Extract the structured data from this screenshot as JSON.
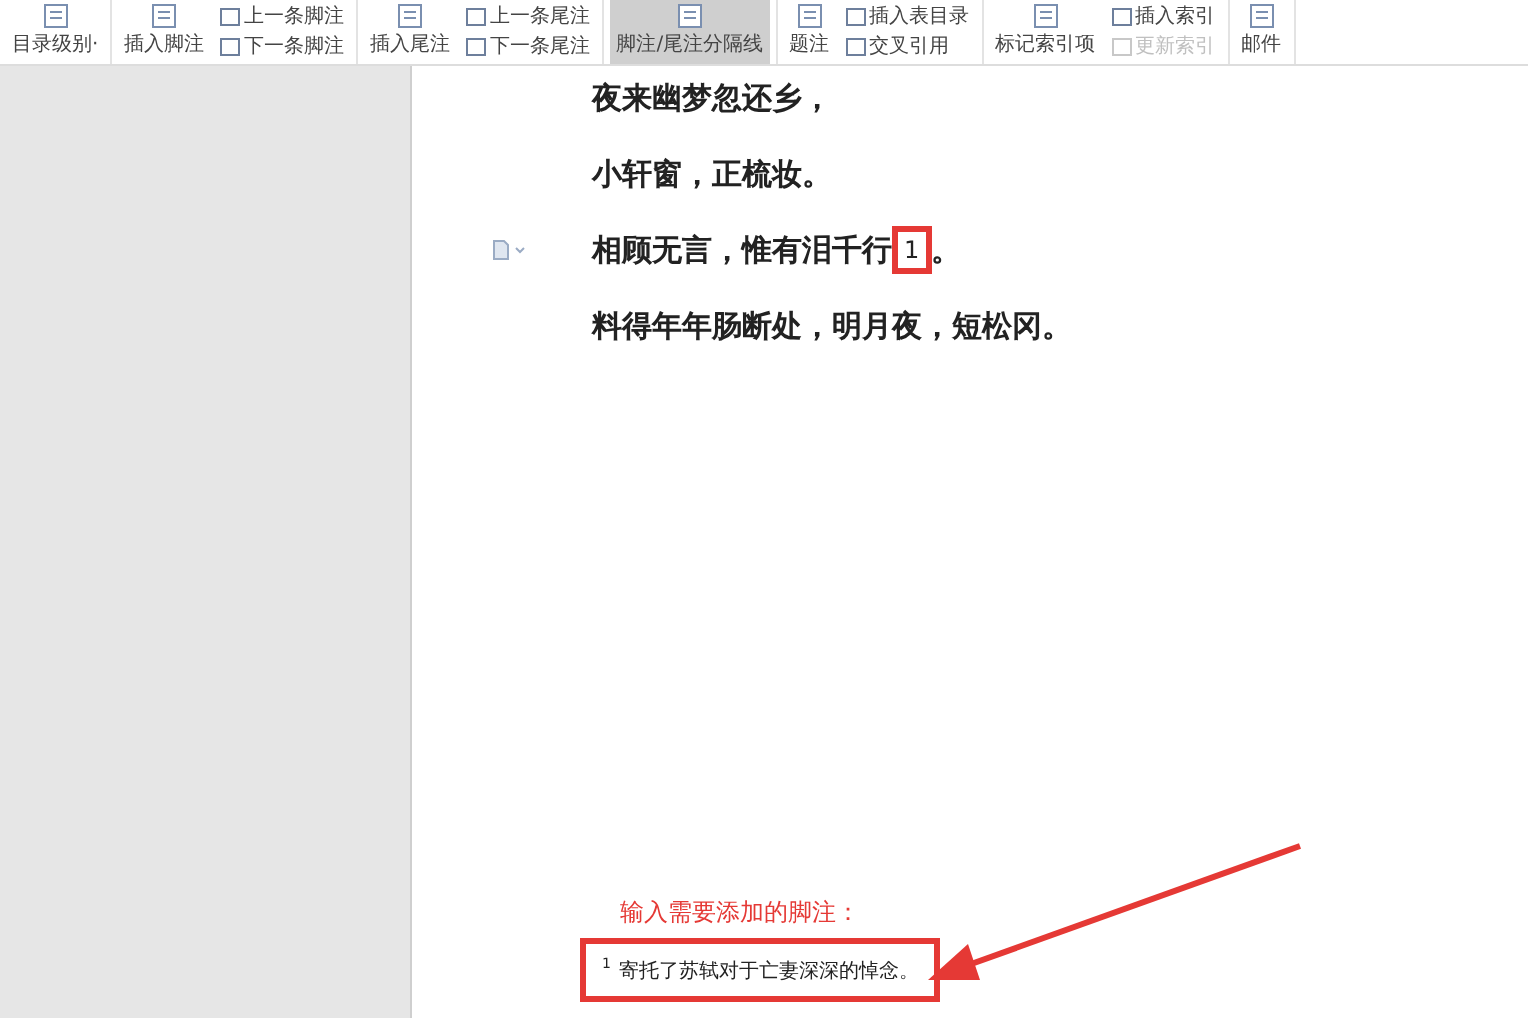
{
  "ribbon": {
    "groups": [
      {
        "items": [
          {
            "kind": "large",
            "label": "目录级别·",
            "selected": false,
            "disabled": false
          }
        ]
      },
      {
        "items": [
          {
            "kind": "large",
            "label": "插入脚注",
            "selected": false,
            "disabled": false
          },
          {
            "kind": "small",
            "labels": [
              {
                "label": "上一条脚注",
                "disabled": false
              },
              {
                "label": "下一条脚注",
                "disabled": false
              }
            ]
          }
        ]
      },
      {
        "items": [
          {
            "kind": "large",
            "label": "插入尾注",
            "selected": false,
            "disabled": false
          },
          {
            "kind": "small",
            "labels": [
              {
                "label": "上一条尾注",
                "disabled": false
              },
              {
                "label": "下一条尾注",
                "disabled": false
              }
            ]
          }
        ]
      },
      {
        "items": [
          {
            "kind": "large",
            "label": "脚注/尾注分隔线",
            "selected": true,
            "disabled": false
          }
        ]
      },
      {
        "items": [
          {
            "kind": "large",
            "label": "题注",
            "selected": false,
            "disabled": false
          },
          {
            "kind": "small",
            "labels": [
              {
                "label": "插入表目录",
                "disabled": false
              },
              {
                "label": "交叉引用",
                "disabled": false
              }
            ]
          }
        ]
      },
      {
        "items": [
          {
            "kind": "large",
            "label": "标记索引项",
            "selected": false,
            "disabled": false
          },
          {
            "kind": "small",
            "labels": [
              {
                "label": "插入索引",
                "disabled": false
              },
              {
                "label": "更新索引",
                "disabled": true
              }
            ]
          }
        ]
      },
      {
        "items": [
          {
            "kind": "large",
            "label": "邮件",
            "selected": false,
            "disabled": false
          }
        ]
      }
    ]
  },
  "document": {
    "lines": [
      {
        "text": "夜来幽梦忽还乡，"
      },
      {
        "text": "小轩窗，正梳妆。"
      },
      {
        "text": "相顾无言，惟有泪千行",
        "footnote_mark": "1",
        "after": "。",
        "highlighted": true
      },
      {
        "text": "料得年年肠断处，明月夜，短松冈。"
      }
    ],
    "callout": "输入需要添加的脚注：",
    "footnote": {
      "mark": "1",
      "text": "寄托了苏轼对于亡妻深深的悼念。",
      "highlighted": true
    }
  }
}
